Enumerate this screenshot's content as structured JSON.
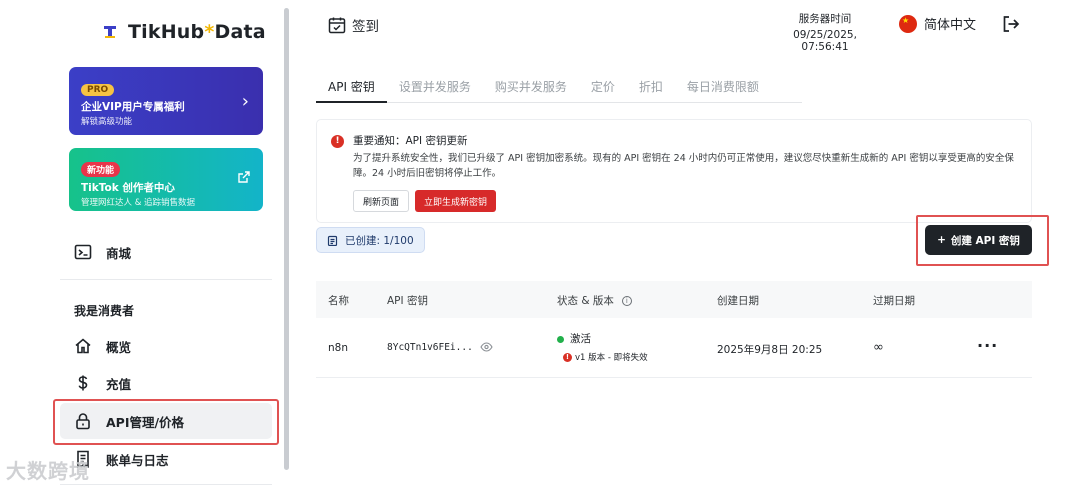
{
  "brand": {
    "name_main": "TikHub",
    "name_star": "*",
    "name_tail": "Data"
  },
  "promos": {
    "pro": {
      "badge": "PRO",
      "title": "企业VIP用户专属福利",
      "subtitle": "解锁高级功能"
    },
    "new": {
      "badge": "新功能",
      "title": "TikTok 创作者中心",
      "subtitle": "管理网红达人 & 追踪销售数据"
    }
  },
  "sidebar": {
    "shop": "商城",
    "section_label": "我是消费者",
    "items": [
      {
        "label": "概览",
        "icon": "home-icon"
      },
      {
        "label": "充值",
        "icon": "dollar-icon"
      },
      {
        "label": "API管理/价格",
        "icon": "lock-icon"
      },
      {
        "label": "账单与日志",
        "icon": "receipt-icon"
      }
    ]
  },
  "header": {
    "checkin": "签到",
    "server_time_label": "服务器时间",
    "server_time_value": "09/25/2025, 07:56:41",
    "language": "简体中文"
  },
  "tabs": [
    "API 密钥",
    "设置并发服务",
    "购买并发服务",
    "定价",
    "折扣",
    "每日消费限额"
  ],
  "notice": {
    "title": "重要通知：API 密钥更新",
    "body": "为了提升系统安全性，我们已升级了 API 密钥加密系统。现有的 API 密钥在 24 小时内仍可正常使用，建议您尽快重新生成新的 API 密钥以享受更高的安全保障。24 小时后旧密钥将停止工作。",
    "refresh_label": "刷新页面",
    "regen_label": "立即生成新密钥"
  },
  "created_count": "已创建: 1/100",
  "create_button": "创建 API 密钥",
  "table": {
    "headers": [
      "名称",
      "API 密钥",
      "状态 & 版本",
      "创建日期",
      "过期日期"
    ],
    "rows": [
      {
        "name": "n8n",
        "key": "8YcQTn1v6FEi...",
        "status": "激活",
        "version": "v1 版本 - 即将失效",
        "created": "2025年9月8日 20:25",
        "expires": "∞"
      }
    ]
  },
  "watermark": "大数跨境",
  "colors": {
    "accent": "#1f2328",
    "danger": "#d72a2a",
    "success": "#22b04b",
    "highlight": "#e05252"
  }
}
